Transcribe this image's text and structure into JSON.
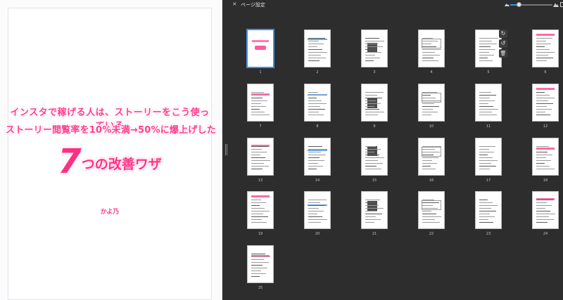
{
  "preview": {
    "line1": "インスタで稼げる人は、ストーリーをこう使っている",
    "line2": "ストーリー閲覧率を10%未満→50%に爆上げした",
    "title_big": "7",
    "title_rest": "つの改善ワザ",
    "author": "かよ乃"
  },
  "panel": {
    "title": "ページ設定",
    "close_label": "×",
    "zoom_level": 0.2
  },
  "thumb_tools": {
    "rotate_right": "↻",
    "rotate_left": "↺",
    "delete": "🗑"
  },
  "pages": [
    "1",
    "2",
    "3",
    "4",
    "5",
    "6",
    "7",
    "8",
    "9",
    "10",
    "11",
    "12",
    "13",
    "14",
    "15",
    "16",
    "17",
    "18",
    "19",
    "20",
    "21",
    "22",
    "23",
    "24",
    "25"
  ],
  "selected_page": "1",
  "colors": {
    "accent": "#ff3d8c",
    "selection": "#3f8ef7",
    "panel_bg": "#2d2d2d"
  },
  "icons": {
    "close": "close-icon",
    "zoom_out": "mountain-small-icon",
    "zoom_in": "mountain-large-icon",
    "rotate_right": "rotate-cw-icon",
    "rotate_left": "rotate-ccw-icon",
    "delete": "trash-icon"
  }
}
